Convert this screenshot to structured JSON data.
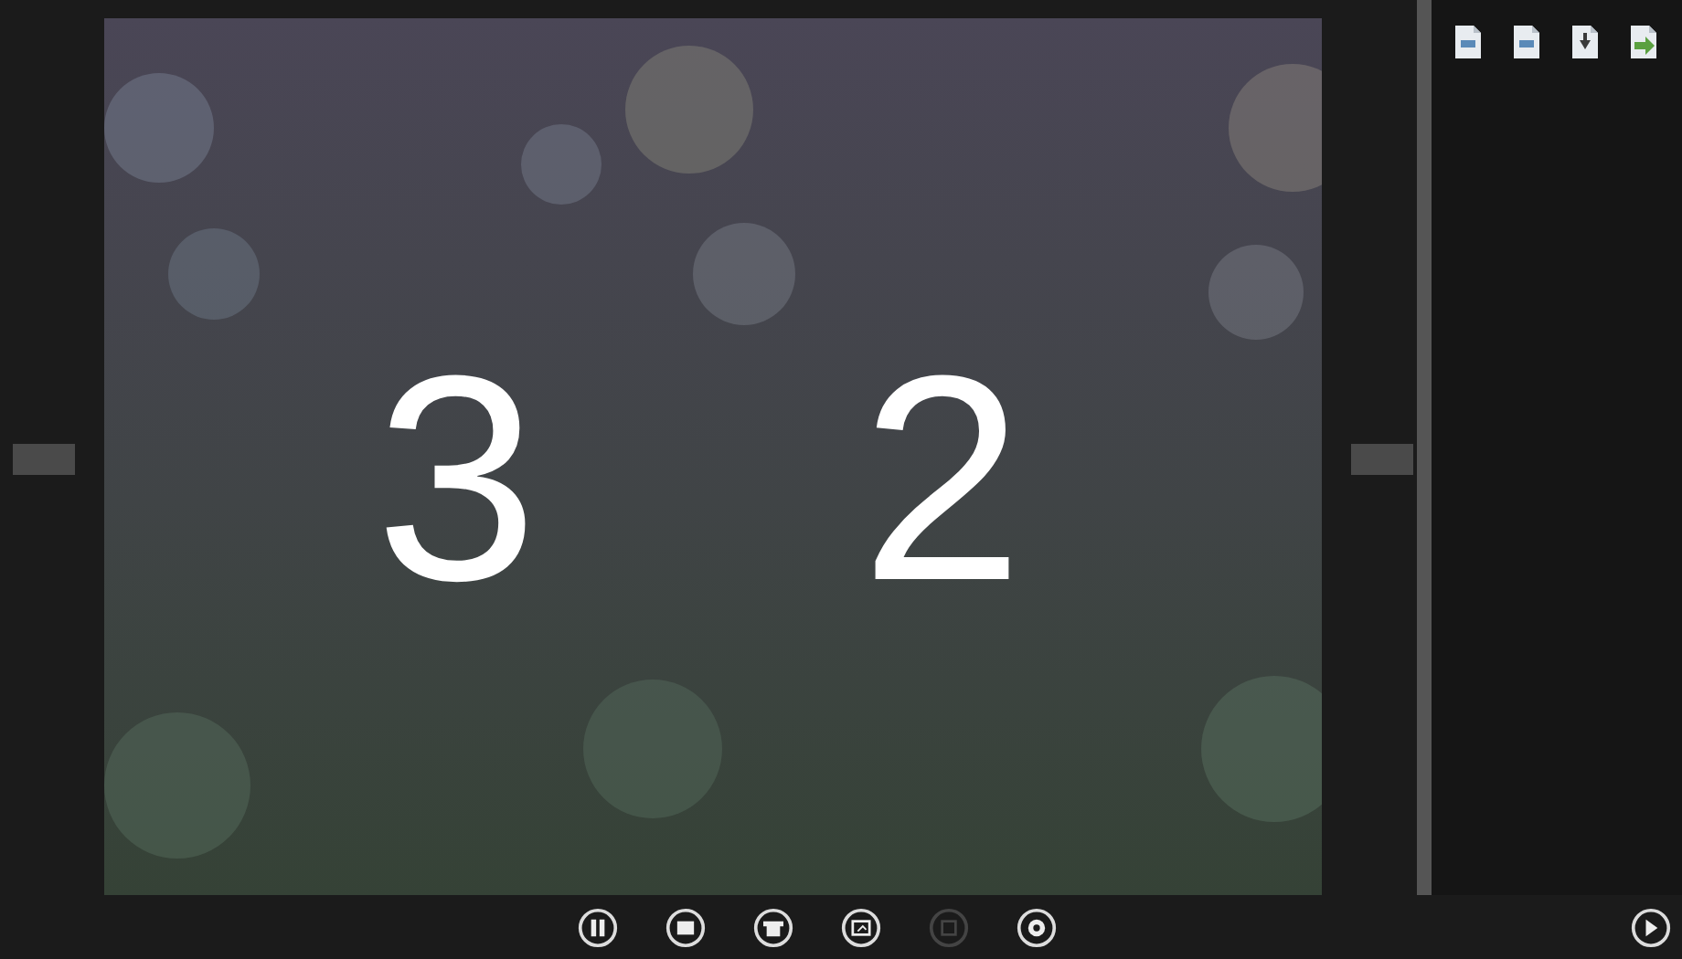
{
  "slide": {
    "numbers": [
      {
        "text": "3"
      },
      {
        "text": "2"
      }
    ]
  },
  "nav": {
    "prev": {
      "disabled": false
    },
    "next": {
      "disabled": false
    }
  },
  "side_panel": {
    "tools": [
      {
        "disabled": false
      },
      {
        "disabled": false
      },
      {
        "disabled": false
      },
      {
        "disabled": false
      }
    ]
  },
  "toolbar": [
    {
      "disabled": false
    },
    {
      "disabled": false
    },
    {
      "disabled": false
    },
    {
      "disabled": false
    },
    {
      "disabled": true
    },
    {
      "disabled": false
    }
  ],
  "corner_button": {
    "disabled": false
  }
}
